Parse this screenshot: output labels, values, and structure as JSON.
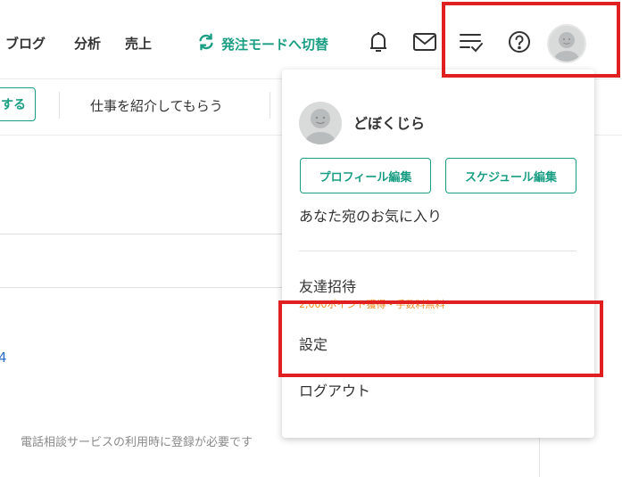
{
  "header": {
    "nav": [
      "ブログ",
      "分析",
      "売上"
    ],
    "mode_switch_label": "発注モードへ切替",
    "icons": [
      "bell-icon",
      "mail-icon",
      "task-list-icon",
      "help-icon",
      "avatar"
    ]
  },
  "subbar": {
    "button_label": "する",
    "link_label": "仕事を紹介してもらう"
  },
  "background": {
    "fragment": "4",
    "phone_note": "電話相談サービスの利用時に登録が必要です"
  },
  "dropdown": {
    "user_name": "どぼくじら",
    "profile_edit_label": "プロフィール編集",
    "schedule_edit_label": "スケジュール編集",
    "favorites_label": "あなた宛のお気に入り",
    "invite_label": "友達招待",
    "invite_subtext": "2,000ポイント獲得・手数料無料",
    "settings_label": "設定",
    "logout_label": "ログアウト"
  },
  "colors": {
    "accent": "#1a9e83",
    "highlight": "#e02020",
    "promo": "#f08a24"
  }
}
